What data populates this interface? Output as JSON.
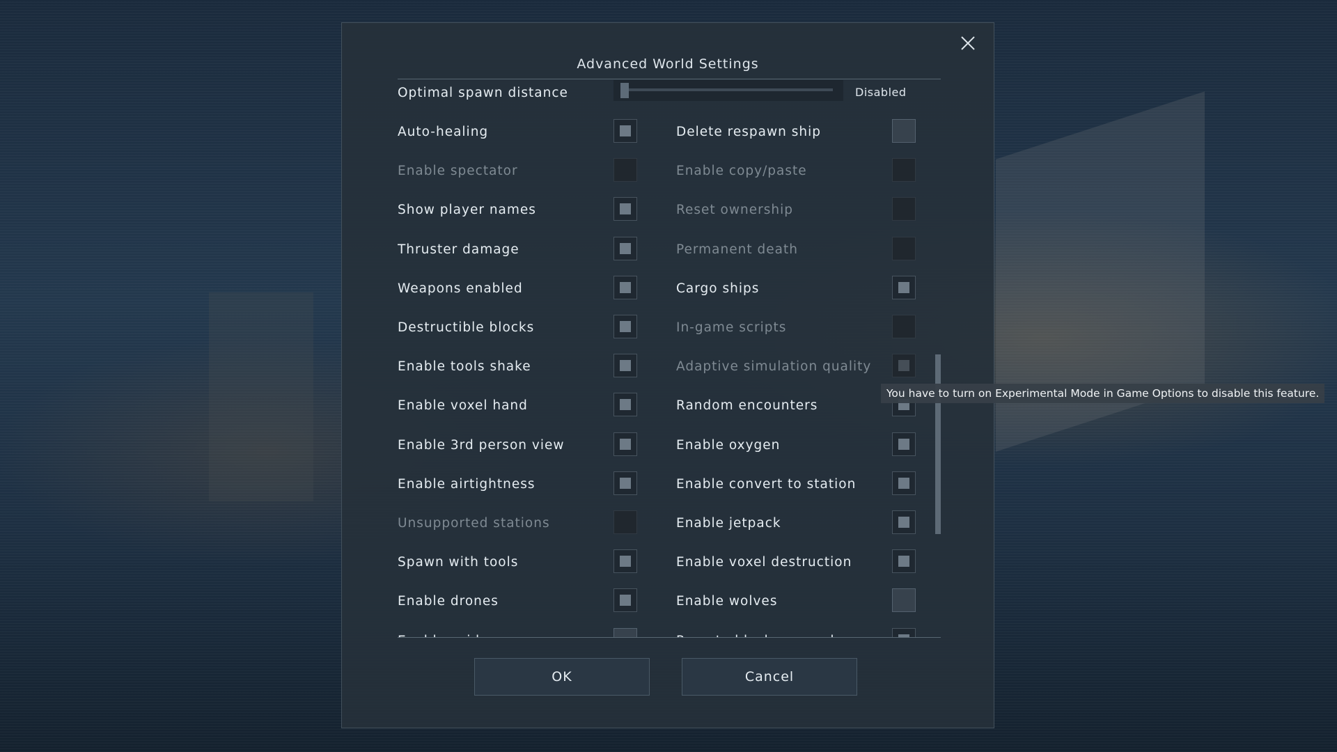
{
  "dialog": {
    "title": "Advanced World Settings",
    "ok_label": "OK",
    "cancel_label": "Cancel"
  },
  "slider": {
    "label": "Optimal spawn distance",
    "value_text": "Disabled",
    "level_fraction": 0.0
  },
  "left_column": [
    {
      "label": "Auto-healing",
      "enabled": true,
      "checked": true
    },
    {
      "label": "Enable spectator",
      "enabled": false,
      "checked": false
    },
    {
      "label": "Show player names",
      "enabled": true,
      "checked": true
    },
    {
      "label": "Thruster damage",
      "enabled": true,
      "checked": true
    },
    {
      "label": "Weapons enabled",
      "enabled": true,
      "checked": true
    },
    {
      "label": "Destructible blocks",
      "enabled": true,
      "checked": true
    },
    {
      "label": "Enable tools shake",
      "enabled": true,
      "checked": true
    },
    {
      "label": "Enable voxel hand",
      "enabled": true,
      "checked": true
    },
    {
      "label": "Enable 3rd person view",
      "enabled": true,
      "checked": true
    },
    {
      "label": "Enable airtightness",
      "enabled": true,
      "checked": true
    },
    {
      "label": "Unsupported stations",
      "enabled": false,
      "checked": false
    },
    {
      "label": "Spawn with tools",
      "enabled": true,
      "checked": true
    },
    {
      "label": "Enable drones",
      "enabled": true,
      "checked": true
    },
    {
      "label": "Enable spiders",
      "enabled": true,
      "checked": false
    }
  ],
  "right_column": [
    {
      "label": "Delete respawn ship",
      "enabled": true,
      "checked": false
    },
    {
      "label": "Enable copy/paste",
      "enabled": false,
      "checked": false
    },
    {
      "label": "Reset ownership",
      "enabled": false,
      "checked": false
    },
    {
      "label": "Permanent death",
      "enabled": false,
      "checked": false
    },
    {
      "label": "Cargo ships",
      "enabled": true,
      "checked": true
    },
    {
      "label": "In-game scripts",
      "enabled": false,
      "checked": false
    },
    {
      "label": "Adaptive simulation quality",
      "enabled": false,
      "checked": true
    },
    {
      "label": "Random encounters",
      "enabled": true,
      "checked": true
    },
    {
      "label": "Enable oxygen",
      "enabled": true,
      "checked": true
    },
    {
      "label": "Enable convert to station",
      "enabled": true,
      "checked": true
    },
    {
      "label": "Enable jetpack",
      "enabled": true,
      "checked": true
    },
    {
      "label": "Enable voxel destruction",
      "enabled": true,
      "checked": true
    },
    {
      "label": "Enable wolves",
      "enabled": true,
      "checked": false
    },
    {
      "label": "Remote block removal",
      "enabled": true,
      "checked": true
    }
  ],
  "tooltip": {
    "text": "You have to turn on Experimental Mode in Game Options to disable this feature."
  },
  "icons": {
    "close": "close-icon"
  },
  "colors": {
    "panel": "#26303a",
    "text": "#e6edf2",
    "disabled_text": "#7f8a93",
    "checkbox_fill": "#6d7a86"
  }
}
